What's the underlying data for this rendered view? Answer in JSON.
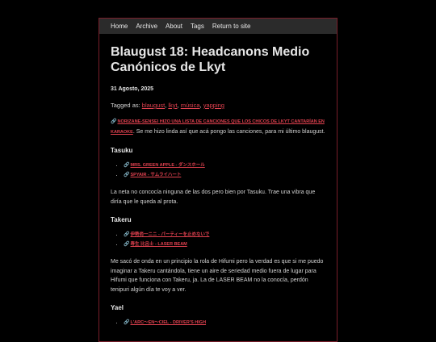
{
  "nav": {
    "items": [
      "Home",
      "Archive",
      "About",
      "Tags",
      "Return to site"
    ]
  },
  "post": {
    "title": "Blaugust 18: Headcanons Medio Canónicos de Lkyt",
    "date": "31 Agosto, 2025",
    "tagged_label": "Tagged as:",
    "tags": [
      "blaugust",
      "lkyt",
      "música",
      "yapping"
    ],
    "intro_link": "NORIZANE-SENSEI HIZO UNA LISTA DE CANCIONES QUE LOS CHICOS DE LKYT CANTARÍAN EN KARAOKE",
    "intro_text": ". Se me hizo linda así que acá pongo las canciones, para mi último blaugust.",
    "sections": [
      {
        "heading": "Tasuku",
        "links": [
          "MRS. GREEN APPLE - ダンスホール",
          "SPYAIR - サムライハート"
        ],
        "text": "La neta no concocía ninguna de las dos pero bien por Tasuku. Trae una vibra que diría que le queda al prota."
      },
      {
        "heading": "Takeru",
        "links": [
          "伊勢尚一ニニ - パーティーを止めないで",
          "寿生 比呂士 - LASER BEAM"
        ],
        "text": "Me sacó de onda en un principio la rola de Hifumi pero la verdad es que si me puedo imaginar a Takeru cantándola, tiene un aire de seriedad medio fuera de lugar para Hifumi que funciona con Takeru, ja. La de LASER BEAM no la conocía, perdón tenipuri algún día te voy a ver."
      },
      {
        "heading": "Yael",
        "links": [
          "L'ARC〜EN〜CIEL - DRIVER'S HIGH"
        ]
      }
    ]
  },
  "icons": {
    "link": "link-icon"
  }
}
